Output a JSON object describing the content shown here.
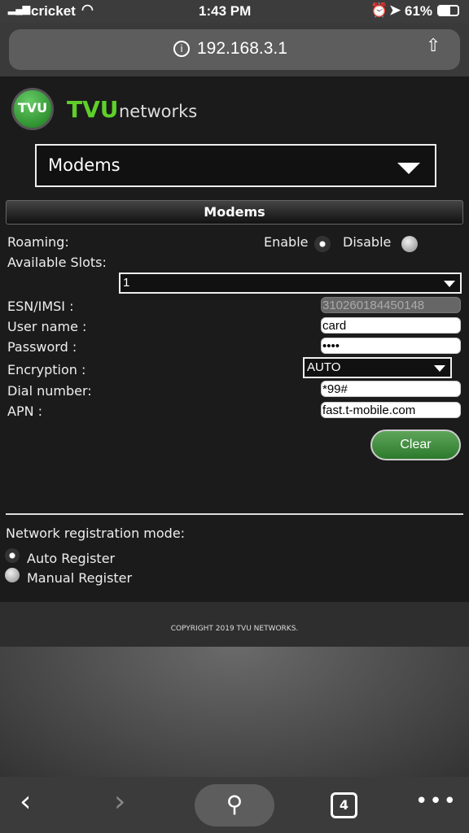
{
  "status_bar": {
    "carrier": "cricket",
    "time": "1:43 PM",
    "battery": "61%"
  },
  "browser": {
    "url": "192.168.3.1",
    "tab_count": "4"
  },
  "logo": {
    "brand": "TVU",
    "suffix": "networks",
    "badge": "TVU"
  },
  "menu_select": {
    "value": "Modems"
  },
  "section": {
    "title": "Modems"
  },
  "roaming": {
    "label": "Roaming:",
    "enable": "Enable",
    "disable": "Disable",
    "selected": "Enable"
  },
  "slots": {
    "label": "Available Slots:",
    "value": "1"
  },
  "fields": {
    "esn": {
      "label": "ESN/IMSI :",
      "value": "310260184450148"
    },
    "username": {
      "label": "User name :",
      "value": "card"
    },
    "password": {
      "label": "Password :",
      "value": "••••"
    },
    "encryption": {
      "label": "Encryption :",
      "value": "AUTO"
    },
    "dial": {
      "label": "Dial number:",
      "value": "*99#"
    },
    "apn": {
      "label": "APN :",
      "value": "fast.t-mobile.com"
    }
  },
  "clear_button": "Clear",
  "registration": {
    "label": "Network registration mode:",
    "auto": "Auto Register",
    "manual": "Manual Register",
    "selected": "Auto Register"
  },
  "footer": "COPYRIGHT 2019 TVU NETWORKS.",
  "colors": {
    "brand_green": "#5fd02a",
    "button_green": "#3f8a3a"
  }
}
